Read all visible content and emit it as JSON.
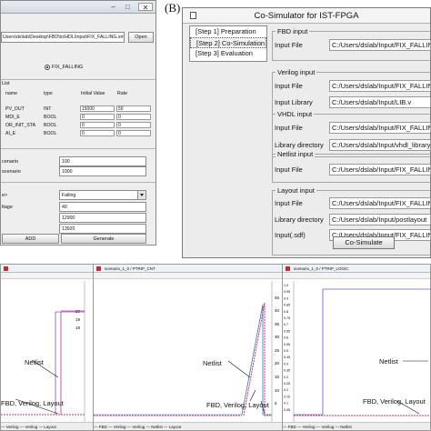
{
  "window_a": {
    "path_value": "Users\\ds\\lab\\Desktop\\FBD\\to\\HDL\\Input\\FIX_FALLING.xml",
    "open_button": "Open",
    "radio_label": "FIX_FALLING",
    "section_label": "List",
    "table": {
      "headers": [
        "name",
        "type",
        "Initial Value",
        "Rate"
      ],
      "rows": [
        {
          "name": "PV_OUT",
          "type": "INT",
          "initial": "15000",
          "rate": "50"
        },
        {
          "name": "MDI_E",
          "type": "BOOL",
          "initial": "0",
          "rate": "0"
        },
        {
          "name": "OR_INIT_STA",
          "type": "BOOL",
          "initial": "0",
          "rate": "0"
        },
        {
          "name": "AI_E",
          "type": "BOOL",
          "initial": "0",
          "rate": "0"
        }
      ]
    },
    "scenario_fields": [
      {
        "label": "cenario",
        "value": "100"
      },
      {
        "label": "scenario",
        "value": "1000"
      }
    ],
    "mode_label": "e>",
    "mode_selected": "Falling",
    "voltage_fields": [
      {
        "label": "ltage",
        "value": "40"
      },
      {
        "label": "",
        "value": "12900"
      },
      {
        "label": "",
        "value": "13920"
      }
    ],
    "add_button": "ADD",
    "generate_button": "Generate"
  },
  "window_b": {
    "panel_letter": "(B)",
    "title": "Co-Simulator for IST-FPGA",
    "steps": [
      "[Step 1] Preparation",
      "[Step 2] Co-Simulation",
      "[Step 3] Evaluation"
    ],
    "groups": {
      "fbd": {
        "title": "FBD input",
        "fields": [
          {
            "label": "Input File",
            "value": "C:/Users/dslab/Input/FIX_FALLING"
          }
        ]
      },
      "verilog": {
        "title": "Verilog input",
        "fields": [
          {
            "label": "Input File",
            "value": "C:/Users/dslab/Input/FIX_FALLIN"
          },
          {
            "label": "Input Library",
            "value": "C:/Users/dslab/Input/LIB.v"
          }
        ]
      },
      "vhdl": {
        "title": "VHDL input",
        "fields": [
          {
            "label": "Input File",
            "value": "C:/Users/dslab/Input/FIX_FALLIN"
          },
          {
            "label": "Library directory",
            "value": "C:/Users/dslab/Input/vhdl_library"
          }
        ]
      },
      "netlist": {
        "title": "Netlist input",
        "fields": [
          {
            "label": "Input File",
            "value": "C:/Users/dslab/Input/FIX_FALLIN"
          }
        ]
      },
      "layout": {
        "title": "Layout input",
        "fields": [
          {
            "label": "Input File",
            "value": "C:/Users/dslab/Input/FIX_FALLIN"
          },
          {
            "label": "Library directory",
            "value": "C:/Users/dslab/Input/postlayout"
          },
          {
            "label": "Input(.sdf)",
            "value": "C:/Users/dslab/Input/FIX_FALLING"
          }
        ]
      }
    },
    "cosim_button": "Co-Simulate"
  },
  "plots": {
    "p1": {
      "title": "",
      "y_ticks": [
        "20",
        "19",
        "18"
      ],
      "annot_netlist": "Netlist",
      "annot_other": "FBD, Verilog, Layout",
      "legend": "— Verilog  — Verilog  — Layout"
    },
    "p2": {
      "title": "scenario_1_0 / PTRIP_CNT",
      "y_ticks": [
        "45",
        "40",
        "35",
        "30",
        "25",
        "20",
        "15",
        "10",
        "5"
      ],
      "annot_netlist": "Netlist",
      "annot_other": "FBD, Verilog, Layout",
      "legend": "— FBD  — Verilog  — Verilog  — Netlist  — Layout"
    },
    "p3": {
      "title": "scenario_1_0 / PTRIP_LOGIC",
      "y_ticks": [
        "1.0",
        "0.95",
        "0.9",
        "0.85",
        "0.8",
        "0.75",
        "0.7",
        "0.65",
        "0.6",
        "0.55",
        "0.5",
        "0.45",
        "0.4",
        "0.35",
        "0.3",
        "0.25",
        "0.2",
        "0.15",
        "0.1",
        "0.05"
      ],
      "annot_netlist": "Netlist",
      "annot_other": "FBD, Verilog, Layout",
      "legend": "— FBD  — Verilog  — Verilog  — Netlist"
    }
  },
  "colors": {
    "netlist": "#cc3366",
    "fbd": "#7755cc",
    "other": "#3377cc"
  }
}
